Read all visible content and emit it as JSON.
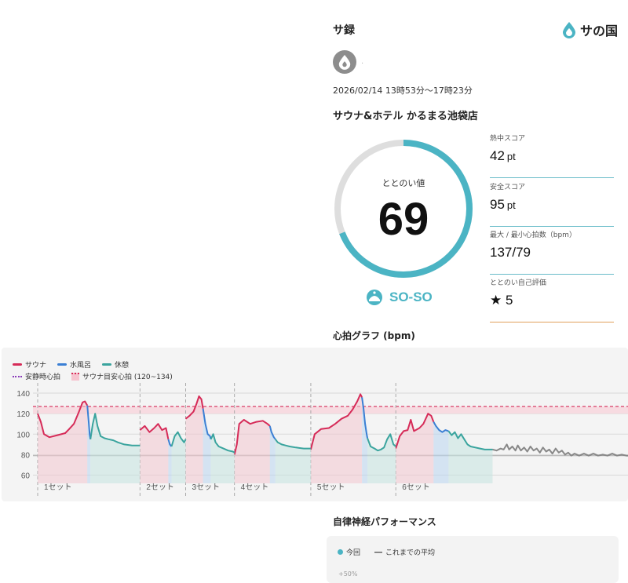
{
  "header": {
    "title": "サ録",
    "brand": "サの国"
  },
  "session": {
    "datetime": "2026/02/14 13時53分～17時23分",
    "facility": "サウナ&ホテル かるまる池袋店",
    "avatar_dot": "·"
  },
  "totonoi": {
    "label": "ととのい値",
    "value": "69",
    "progress": 0.69,
    "mood": "SO-SO"
  },
  "scores": [
    {
      "label": "熱中スコア",
      "value": "42",
      "unit": "pt",
      "accent": "#69bcc9"
    },
    {
      "label": "安全スコア",
      "value": "95",
      "unit": "pt",
      "accent": "#69bcc9"
    },
    {
      "label": "最大 / 最小心拍数（bpm）",
      "value": "137/79",
      "unit": "",
      "accent": "#69bcc9"
    },
    {
      "label": "ととのい自己評価",
      "value": "★ 5",
      "unit": "",
      "accent": "#e0a05a"
    }
  ],
  "graph": {
    "title": "心拍グラフ (bpm)",
    "legend": {
      "sauna": "サウナ",
      "mizuburo": "水風呂",
      "rest": "休憩",
      "resting_hr": "安静時心拍",
      "target_band": "サウナ目安心拍 (120~134)"
    }
  },
  "chart_data": {
    "type": "line",
    "title": "心拍グラフ (bpm)",
    "ylabel": "",
    "yticks": [
      140,
      120,
      100,
      80,
      60
    ],
    "ylim": [
      52,
      150
    ],
    "resting_hr": 79,
    "target_band": [
      120,
      127
    ],
    "sets": [
      {
        "label": "1セット",
        "start": 0,
        "end": 130
      },
      {
        "label": "2セット",
        "start": 130,
        "end": 188
      },
      {
        "label": "3セット",
        "start": 188,
        "end": 250
      },
      {
        "label": "4セット",
        "start": 250,
        "end": 347
      },
      {
        "label": "5セット",
        "start": 347,
        "end": 455
      },
      {
        "label": "6セット",
        "start": 455,
        "end": 750
      }
    ],
    "series": [
      {
        "name": "サウナ",
        "color": "#d62b58",
        "segments": [
          [
            [
              0,
              120
            ],
            [
              4,
              112
            ],
            [
              8,
              100
            ],
            [
              15,
              97
            ],
            [
              25,
              99
            ],
            [
              35,
              101
            ],
            [
              40,
              105
            ],
            [
              46,
              110
            ],
            [
              52,
              121
            ],
            [
              57,
              131
            ],
            [
              60,
              132
            ],
            [
              63,
              128
            ]
          ],
          [
            [
              130,
              104
            ],
            [
              136,
              108
            ],
            [
              142,
              102
            ],
            [
              148,
              106
            ],
            [
              153,
              110
            ],
            [
              158,
              104
            ],
            [
              163,
              106
            ],
            [
              166,
              95
            ]
          ],
          [
            [
              188,
              115
            ],
            [
              193,
              118
            ],
            [
              198,
              122
            ],
            [
              202,
              130
            ],
            [
              205,
              137
            ],
            [
              208,
              134
            ],
            [
              210,
              125
            ]
          ],
          [
            [
              250,
              80
            ],
            [
              253,
              90
            ],
            [
              256,
              110
            ],
            [
              262,
              114
            ],
            [
              270,
              110
            ],
            [
              278,
              112
            ],
            [
              286,
              113
            ],
            [
              292,
              110
            ],
            [
              295,
              108
            ]
          ],
          [
            [
              347,
              85
            ],
            [
              352,
              100
            ],
            [
              360,
              105
            ],
            [
              370,
              106
            ],
            [
              378,
              110
            ],
            [
              386,
              115
            ],
            [
              394,
              118
            ],
            [
              400,
              124
            ],
            [
              406,
              132
            ],
            [
              410,
              139
            ],
            [
              412,
              136
            ]
          ],
          [
            [
              455,
              86
            ],
            [
              460,
              98
            ],
            [
              465,
              103
            ],
            [
              470,
              104
            ],
            [
              474,
              114
            ],
            [
              478,
              103
            ],
            [
              485,
              106
            ],
            [
              490,
              110
            ],
            [
              496,
              120
            ],
            [
              500,
              118
            ],
            [
              503,
              112
            ]
          ]
        ]
      },
      {
        "name": "水風呂",
        "color": "#3b7fd4",
        "segments": [
          [
            [
              63,
              128
            ],
            [
              65,
              110
            ],
            [
              66,
              100
            ],
            [
              67,
              95
            ]
          ],
          [
            [
              166,
              95
            ],
            [
              168,
              90
            ],
            [
              170,
              88
            ]
          ],
          [
            [
              210,
              125
            ],
            [
              213,
              110
            ],
            [
              216,
              100
            ],
            [
              219,
              98
            ],
            [
              220,
              95
            ]
          ],
          [
            [
              295,
              108
            ],
            [
              297,
              102
            ],
            [
              300,
              97
            ],
            [
              302,
              95
            ]
          ],
          [
            [
              412,
              136
            ],
            [
              414,
              125
            ],
            [
              416,
              110
            ],
            [
              418,
              100
            ],
            [
              419,
              96
            ]
          ],
          [
            [
              503,
              112
            ],
            [
              506,
              108
            ],
            [
              510,
              104
            ],
            [
              514,
              102
            ],
            [
              518,
              104
            ],
            [
              522,
              103
            ]
          ]
        ]
      },
      {
        "name": "休憩",
        "color": "#3aa49e",
        "segments": [
          [
            [
              67,
              95
            ],
            [
              70,
              110
            ],
            [
              73,
              120
            ],
            [
              76,
              108
            ],
            [
              80,
              98
            ],
            [
              85,
              96
            ],
            [
              90,
              95
            ],
            [
              96,
              94
            ],
            [
              102,
              92
            ],
            [
              110,
              90
            ],
            [
              120,
              89
            ],
            [
              128,
              89
            ],
            [
              130,
              89
            ]
          ],
          [
            [
              170,
              88
            ],
            [
              174,
              98
            ],
            [
              178,
              102
            ],
            [
              182,
              96
            ],
            [
              186,
              92
            ],
            [
              188,
              95
            ]
          ],
          [
            [
              220,
              95
            ],
            [
              223,
              100
            ],
            [
              226,
              92
            ],
            [
              230,
              88
            ],
            [
              236,
              86
            ],
            [
              242,
              84
            ],
            [
              248,
              83
            ],
            [
              250,
              82
            ]
          ],
          [
            [
              302,
              95
            ],
            [
              305,
              92
            ],
            [
              310,
              90
            ],
            [
              315,
              89
            ],
            [
              320,
              88
            ],
            [
              328,
              87
            ],
            [
              338,
              86
            ],
            [
              345,
              86
            ],
            [
              347,
              86
            ]
          ],
          [
            [
              419,
              96
            ],
            [
              423,
              88
            ],
            [
              428,
              86
            ],
            [
              432,
              84
            ],
            [
              436,
              85
            ],
            [
              440,
              87
            ],
            [
              444,
              95
            ],
            [
              448,
              100
            ],
            [
              452,
              90
            ],
            [
              455,
              88
            ]
          ],
          [
            [
              522,
              103
            ],
            [
              526,
              99
            ],
            [
              530,
              102
            ],
            [
              534,
              96
            ],
            [
              538,
              100
            ],
            [
              542,
              95
            ],
            [
              546,
              90
            ],
            [
              550,
              88
            ],
            [
              556,
              87
            ],
            [
              562,
              86
            ],
            [
              568,
              85
            ],
            [
              574,
              85
            ],
            [
              578,
              85
            ]
          ]
        ]
      },
      {
        "name": "",
        "color": "#888888",
        "segments": [
          [
            [
              578,
              85
            ],
            [
              583,
              84
            ],
            [
              588,
              86
            ],
            [
              592,
              85
            ],
            [
              596,
              90
            ],
            [
              599,
              85
            ],
            [
              603,
              88
            ],
            [
              607,
              84
            ],
            [
              610,
              89
            ],
            [
              614,
              84
            ],
            [
              618,
              87
            ],
            [
              622,
              83
            ],
            [
              626,
              88
            ],
            [
              630,
              84
            ],
            [
              634,
              86
            ],
            [
              638,
              82
            ],
            [
              642,
              87
            ],
            [
              646,
              83
            ],
            [
              650,
              85
            ],
            [
              654,
              81
            ],
            [
              658,
              86
            ],
            [
              662,
              82
            ],
            [
              666,
              84
            ],
            [
              670,
              80
            ],
            [
              674,
              82
            ],
            [
              678,
              79
            ],
            [
              682,
              81
            ],
            [
              688,
              79
            ],
            [
              694,
              81
            ],
            [
              700,
              79
            ],
            [
              706,
              81
            ],
            [
              712,
              79
            ],
            [
              718,
              80
            ],
            [
              724,
              79
            ],
            [
              730,
              81
            ],
            [
              736,
              79
            ],
            [
              742,
              80
            ],
            [
              748,
              79
            ],
            [
              750,
              79
            ]
          ]
        ]
      }
    ]
  },
  "autonomic": {
    "title": "自律神経パフォーマンス",
    "legend_today": "今回",
    "legend_avg": "これまでの平均",
    "axis_label": "+50%"
  }
}
